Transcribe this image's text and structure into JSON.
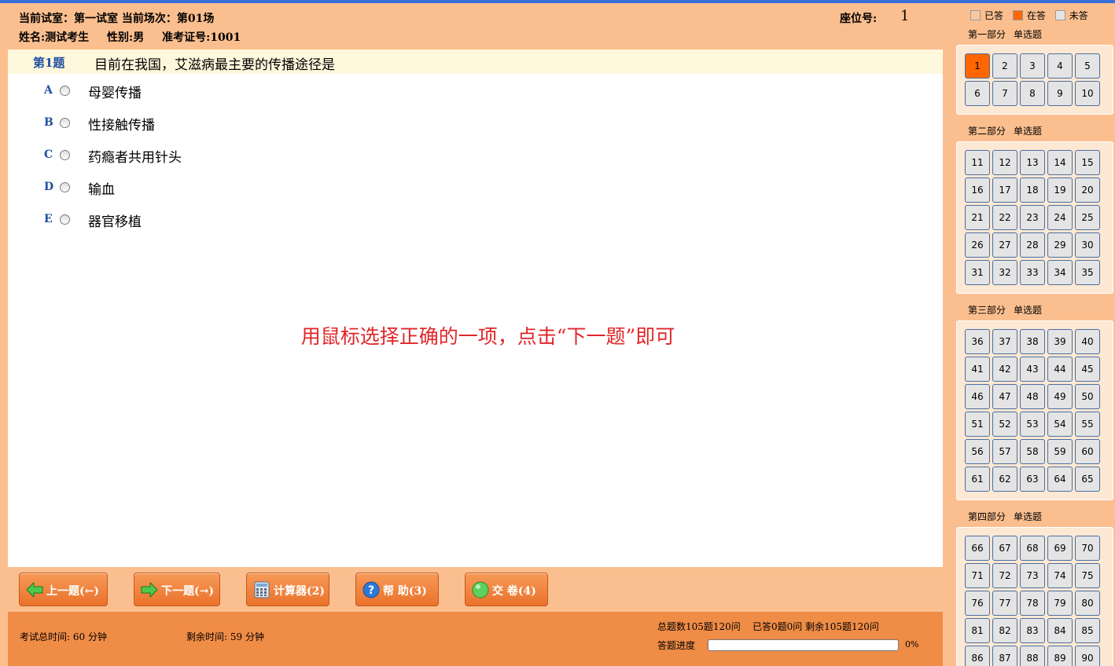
{
  "header": {
    "room_label": "当前试室：第一试室",
    "session_label": "当前场次：第01场",
    "name_label": "姓名:测试考生",
    "gender_label": "性别:男",
    "ticket_label": "准考证号:1001",
    "seat_label": "座位号:",
    "seat_value": "1"
  },
  "question": {
    "number_label": "第1题",
    "text": "目前在我国，艾滋病最主要的传播途径是",
    "options": [
      {
        "letter": "A",
        "text": "母婴传播"
      },
      {
        "letter": "B",
        "text": "性接触传播"
      },
      {
        "letter": "C",
        "text": "药瘾者共用针头"
      },
      {
        "letter": "D",
        "text": "输血"
      },
      {
        "letter": "E",
        "text": "器官移植"
      }
    ],
    "hint": "用鼠标选择正确的一项，点击“下一题”即可"
  },
  "buttons": {
    "prev": "上一题(←)",
    "next": "下一题(→)",
    "calc": "计算器(2)",
    "help": "帮  助(3)",
    "submit": "交  卷(4)"
  },
  "footer": {
    "total_time": "考试总时间:  60 分钟",
    "remaining_time": "剩余时间:  59 分钟",
    "question_count": "总题数105题120问",
    "answered": "已答0题0问  剩余105题120问",
    "progress_label": "答题进度",
    "progress_value": 0,
    "progress_text": "0%"
  },
  "legend": {
    "answered": "已答",
    "answering": "在答",
    "unanswered": "未答",
    "colors": {
      "answered": "#f7c9a3",
      "answering": "#ff6600",
      "unanswered": "#e4e4e4"
    }
  },
  "sections": [
    {
      "name": "第一部分",
      "type": "单选题",
      "start": 1,
      "end": 10
    },
    {
      "name": "第二部分",
      "type": "单选题",
      "start": 11,
      "end": 35
    },
    {
      "name": "第三部分",
      "type": "单选题",
      "start": 36,
      "end": 65
    },
    {
      "name": "第四部分",
      "type": "单选题",
      "start": 66,
      "end": 90
    }
  ],
  "current_question": 1
}
